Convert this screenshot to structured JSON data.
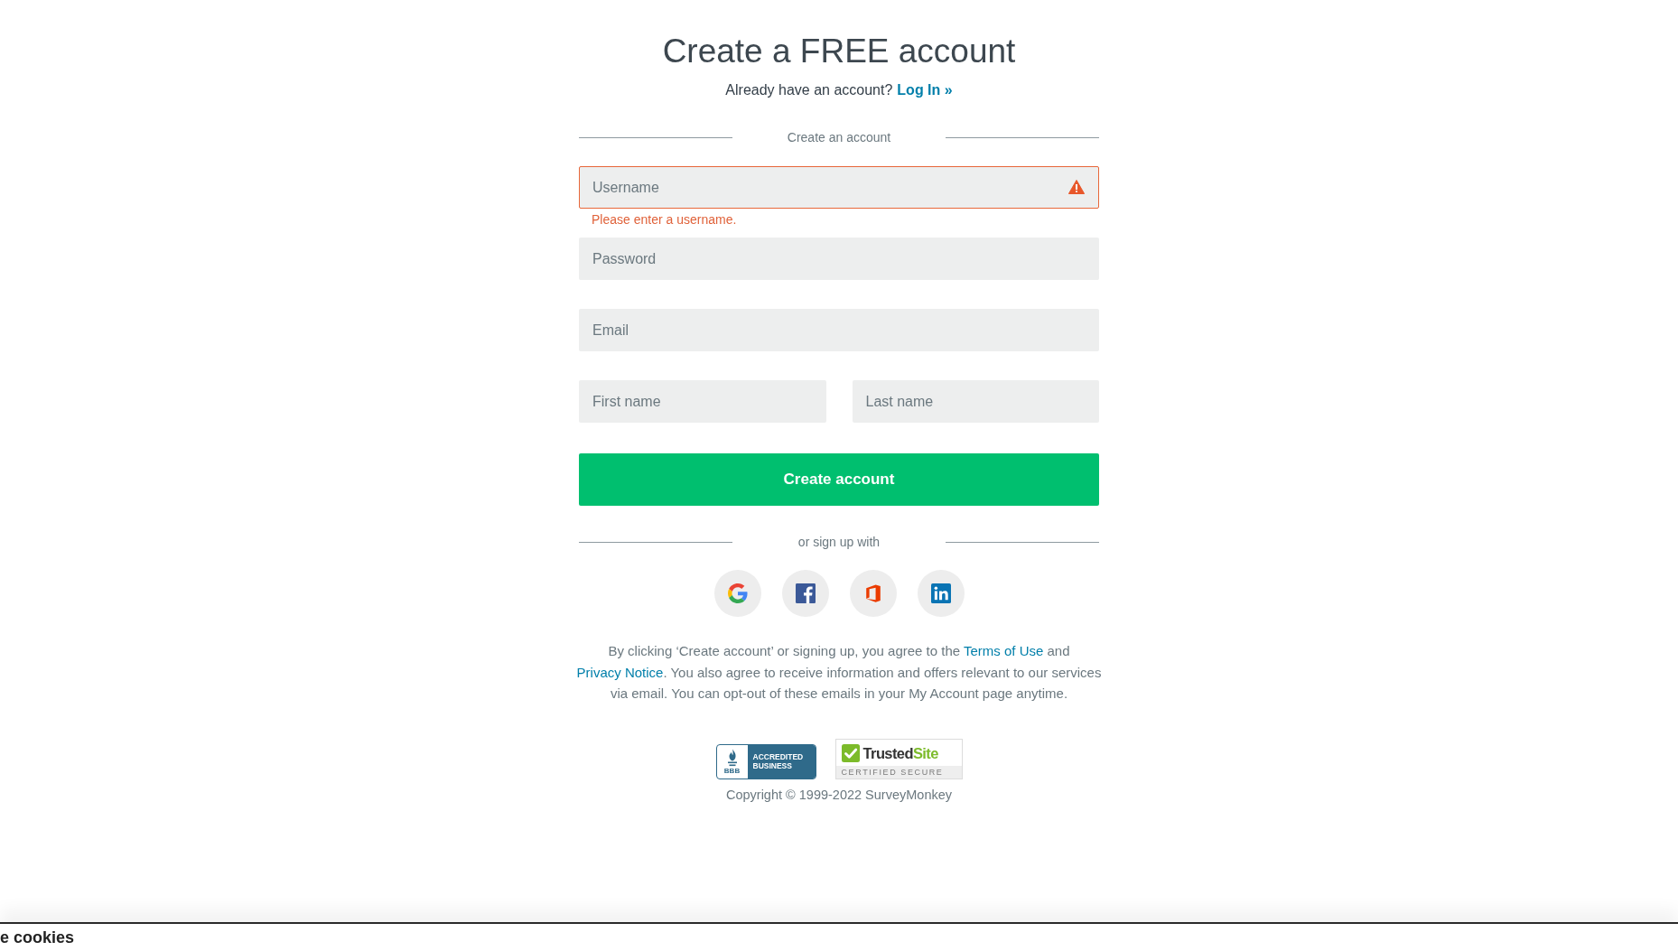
{
  "header": {
    "title": "Create a FREE account",
    "login_prompt": "Already have an account?",
    "login_link": "Log In »"
  },
  "form": {
    "section_label": "Create an account",
    "fields": [
      {
        "placeholder": "Username",
        "invalid": true,
        "error": "Please enter a username."
      },
      {
        "placeholder": "Password",
        "invalid": false
      },
      {
        "placeholder": "Email",
        "invalid": false
      }
    ],
    "name_fields": [
      {
        "placeholder": "First name",
        "invalid": false
      },
      {
        "placeholder": "Last name",
        "invalid": false
      }
    ],
    "submit_button": "Create account"
  },
  "social_signup": {
    "label": "or sign up with",
    "providers": [
      {
        "kind": "google"
      },
      {
        "kind": "facebook"
      },
      {
        "kind": "office"
      },
      {
        "kind": "linkedin"
      }
    ]
  },
  "legal_notice": [
    {
      "kind": "text",
      "text": "By clicking ‘Create account’ or signing up, you agree to the "
    },
    {
      "kind": "link",
      "text": "Terms of Use"
    },
    {
      "kind": "text",
      "text": " and "
    },
    {
      "kind": "link",
      "text": "Privacy Notice"
    },
    {
      "kind": "text",
      "text": ". You also agree to receive information and offers relevant to our services via email. You can opt-out of these emails in your My Account page anytime."
    }
  ],
  "badges": [
    {
      "kind": "accreditation",
      "logo_text": "BBB",
      "lines": [
        "ACCREDITED",
        "BUSINESS"
      ]
    },
    {
      "kind": "trust_seal",
      "name_parts": [
        "Trusted",
        "Site"
      ],
      "caption": "CERTIFIED SECURE"
    }
  ],
  "copyright": "Copyright © 1999-2022 SurveyMonkey",
  "cookie_banner": {
    "heading": "e cookies"
  }
}
